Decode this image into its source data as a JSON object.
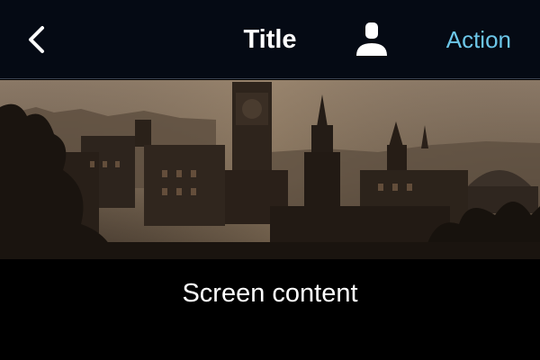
{
  "nav": {
    "back_icon": "chevron-left-icon",
    "title": "Title",
    "profile_icon": "user-icon",
    "action_label": "Action"
  },
  "banner": {
    "image": "city-skyline-photo"
  },
  "main": {
    "content_text": "Screen content"
  },
  "colors": {
    "nav_background": "#050a14",
    "action_accent": "#6cc6e8",
    "content_background": "#000000"
  }
}
